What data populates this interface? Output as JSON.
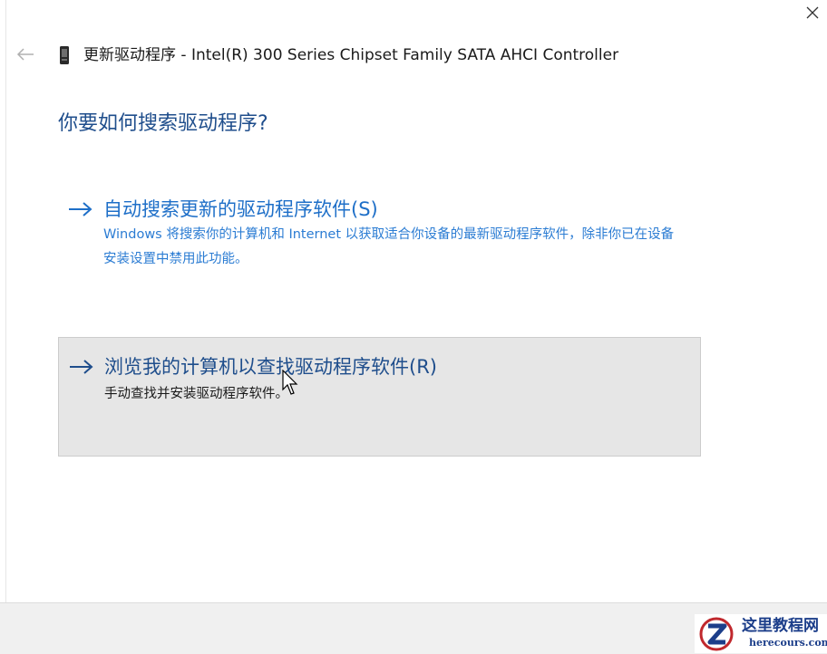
{
  "window": {
    "title": "更新驱动程序 - Intel(R) 300 Series Chipset Family SATA AHCI Controller",
    "close_icon": "close-icon",
    "back_icon": "back-arrow-icon",
    "device_icon": "device-icon"
  },
  "main": {
    "question": "你要如何搜索驱动程序?",
    "options": [
      {
        "title": "自动搜索更新的驱动程序软件(S)",
        "description": "Windows 将搜索你的计算机和 Internet 以获取适合你设备的最新驱动程序软件，除非你已在设备安装设置中禁用此功能。",
        "icon": "arrow-right-icon",
        "color": "#1e6fc8"
      },
      {
        "title": "浏览我的计算机以查找驱动程序软件(R)",
        "description": "手动查找并安装驱动程序软件。",
        "icon": "arrow-right-icon",
        "color": "#1f4e8c"
      }
    ]
  },
  "watermark": {
    "name": "这里教程网",
    "domain": "herecours.com"
  },
  "colors": {
    "accent": "#1e6fc8",
    "heading": "#1f4e8c",
    "hover_bg": "#e6e6e6",
    "footer_bg": "#f0f0f0"
  }
}
